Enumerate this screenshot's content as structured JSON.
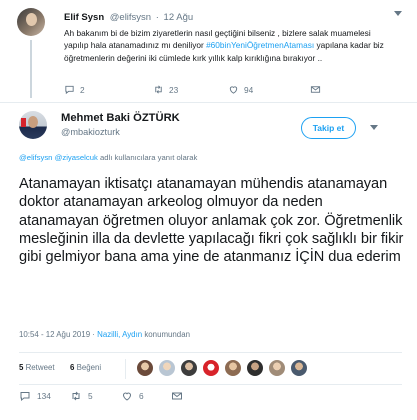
{
  "parent_tweet": {
    "name": "Elif Sysn",
    "handle": "@elifsysn",
    "separator": "·",
    "time": "12 Ağu",
    "text_part1": "Ah bakanım bi de bizim ziyaretlerin nasıl geçtiğini bilseniz , bizlere salak muamelesi yapılıp hala atanamadınız mı deniliyor ",
    "hashtag": "#60binYeniÖğretmenAtaması",
    "text_part2": " yapılana kadar biz öğretmenlerin değerini iki cümlede kırk yıllık kalp kırıklığına bırakıyor ..",
    "reply_count": "2",
    "retweet_count": "23",
    "like_count": "94"
  },
  "main_tweet": {
    "name": "Mehmet Baki ÖZTÜRK",
    "handle": "@mbakiozturk",
    "follow_label": "Takip et",
    "reply_mentions": "@elifsysn @ziyaselcuk",
    "reply_suffix": " adlı kullanıcılara yanıt olarak",
    "text": "Atanamayan iktisatçı atanamayan mühendis atanamayan doktor atanamayan arkeolog olmuyor da neden atanamayan öğretmen oluyor anlamak çok zor. Öğretmenlik mesleğinin illa da devlette yapılacağı fikri çok sağlıklı bir fikir gibi gelmiyor bana ama yine de atanmanız İÇİN dua ederim",
    "timestamp": "10:54 - 12 Ağu 2019",
    "location": "Nazilli, Aydın",
    "location_suffix": " konumundan",
    "retweets": {
      "count": "5",
      "label": "Retweet"
    },
    "likes": {
      "count": "6",
      "label": "Beğeni"
    },
    "reply_count": "134",
    "retweet_count": "5",
    "like_count": "6"
  },
  "icons": {
    "reply": "reply-icon",
    "retweet": "retweet-icon",
    "like": "heart-icon",
    "dm": "envelope-icon",
    "menu": "chevron-down-icon"
  },
  "colors": {
    "accent": "#1da1f2",
    "secondary_text": "#657786",
    "primary_text": "#14171a",
    "border": "#e6ecf0"
  }
}
